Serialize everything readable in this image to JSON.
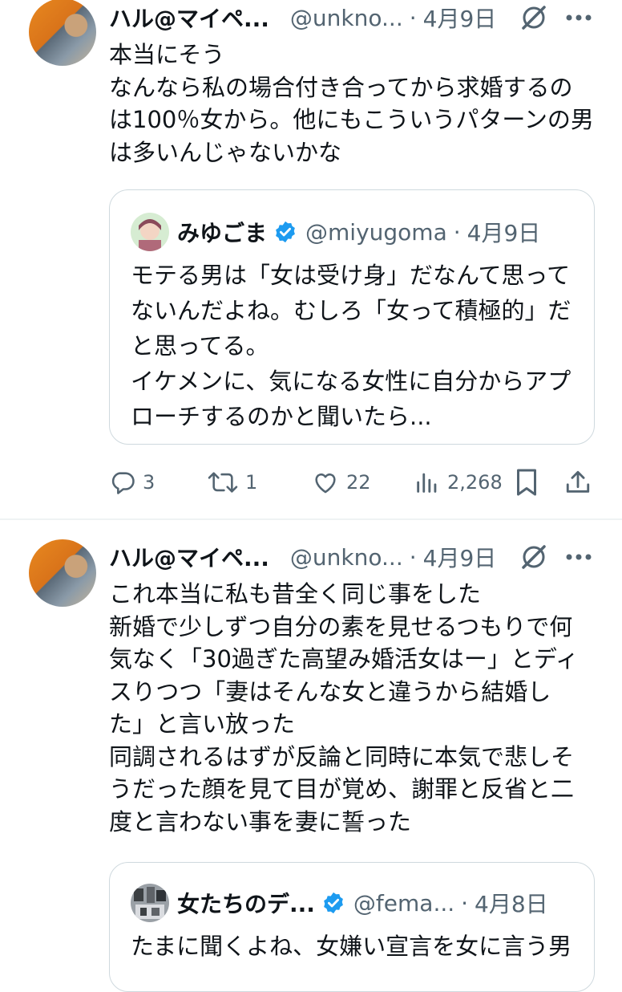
{
  "tweet1": {
    "author_name": "ハル@マイペ...",
    "handle": "@unkno...",
    "separator": "·",
    "date": "4月9日",
    "lines": [
      "本当にそう",
      "なんなら私の場合付き合ってから求婚するの",
      "は100％女から。他にもこういうパターンの男",
      "は多いんじゃないかな"
    ],
    "quote": {
      "author_name": "みゆごま",
      "handle": "@miyugoma",
      "separator": "·",
      "date": "4月9日",
      "lines": [
        "モテる男は「女は受け身」だなんて思って",
        "ないんだよね。むしろ「女って積極的」だ",
        "と思ってる。",
        "イケメンに、気になる女性に自分からアプ",
        "ローチするのかと聞いたら..."
      ]
    },
    "actions": {
      "replies": "3",
      "reposts": "1",
      "likes": "22",
      "views": "2,268"
    }
  },
  "tweet2": {
    "author_name": "ハル@マイペ...",
    "handle": "@unkno...",
    "separator": "·",
    "date": "4月9日",
    "lines": [
      "これ本当に私も昔全く同じ事をした",
      "新婚で少しずつ自分の素を見せるつもりで何",
      "気なく「30過ぎた高望み婚活女はー」とディ",
      "スりつつ「妻はそんな女と違うから結婚し",
      "た」と言い放った",
      "同調されるはずが反論と同時に本気で悲しそ",
      "うだった顔を見て目が覚め、謝罪と反省と二",
      "度と言わない事を妻に誓った"
    ],
    "quote": {
      "author_name": "女たちのデ...",
      "handle": "@fema...",
      "separator": "·",
      "date": "4月8日",
      "lines": [
        "たまに聞くよね、女嫌い宣言を女に言う男"
      ]
    }
  },
  "colors": {
    "text": "#0f1419",
    "secondary": "#536471",
    "verified_blue": "#1d9bf0",
    "border": "#cfd9de"
  },
  "icons": [
    "grok-icon",
    "more-icon",
    "reply-icon",
    "repost-icon",
    "like-icon",
    "views-icon",
    "bookmark-icon",
    "share-icon",
    "verified-badge-icon"
  ]
}
